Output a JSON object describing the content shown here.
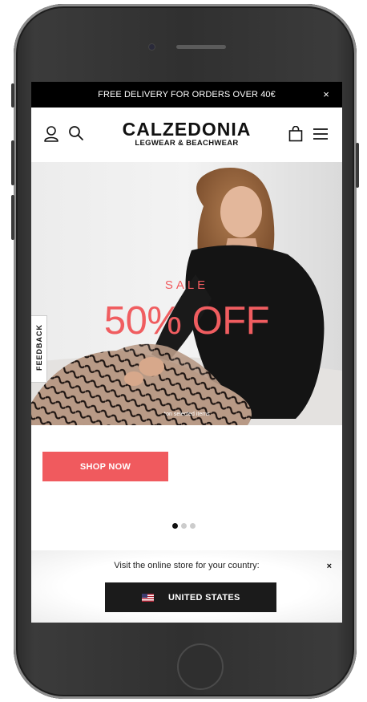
{
  "promo_bar": {
    "text": "FREE DELIVERY FOR ORDERS OVER 40€",
    "close": "×"
  },
  "header": {
    "brand": "CALZEDONIA",
    "tagline": "LEGWEAR & BEACHWEAR",
    "icons": [
      "account-icon",
      "search-icon",
      "bag-icon",
      "menu-icon"
    ]
  },
  "hero": {
    "sale_label": "SALE",
    "headline": "50% OFF",
    "footnote": "*on selected items",
    "accent_color": "#f05d60"
  },
  "feedback_tab": {
    "label": "FEEDBACK"
  },
  "cta": {
    "label": "SHOP NOW",
    "color": "#f05a5e"
  },
  "carousel": {
    "slides": 3,
    "active": 1
  },
  "country_selector": {
    "prompt": "Visit the online store for your country:",
    "close": "×",
    "country": "UNITED STATES",
    "flag_icon": "us-flag-icon"
  }
}
